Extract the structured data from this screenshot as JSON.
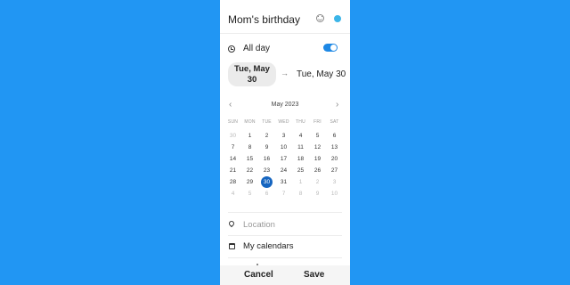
{
  "event": {
    "title": "Mom's birthday",
    "emoji_icon": "smiley-icon",
    "color": "#3BB5E8"
  },
  "all_day": {
    "label": "All day",
    "enabled": true,
    "icon": "clock-icon"
  },
  "dates": {
    "start_line1": "Tue, May",
    "start_line2": "30",
    "arrow": "→",
    "end": "Tue, May 30"
  },
  "calendar": {
    "month_label": "May 2023",
    "prev": "‹",
    "next": "›",
    "weekdays": [
      "SUN",
      "MON",
      "TUE",
      "WED",
      "THU",
      "FRI",
      "SAT"
    ],
    "weeks": [
      [
        {
          "d": "30",
          "m": true
        },
        {
          "d": "1"
        },
        {
          "d": "2"
        },
        {
          "d": "3"
        },
        {
          "d": "4"
        },
        {
          "d": "5"
        },
        {
          "d": "6"
        }
      ],
      [
        {
          "d": "7"
        },
        {
          "d": "8"
        },
        {
          "d": "9"
        },
        {
          "d": "10"
        },
        {
          "d": "11"
        },
        {
          "d": "12"
        },
        {
          "d": "13"
        }
      ],
      [
        {
          "d": "14"
        },
        {
          "d": "15"
        },
        {
          "d": "16"
        },
        {
          "d": "17"
        },
        {
          "d": "18"
        },
        {
          "d": "19"
        },
        {
          "d": "20"
        }
      ],
      [
        {
          "d": "21"
        },
        {
          "d": "22"
        },
        {
          "d": "23"
        },
        {
          "d": "24"
        },
        {
          "d": "25"
        },
        {
          "d": "26"
        },
        {
          "d": "27"
        }
      ],
      [
        {
          "d": "28"
        },
        {
          "d": "29"
        },
        {
          "d": "30",
          "sel": true
        },
        {
          "d": "31"
        },
        {
          "d": "1",
          "m": true
        },
        {
          "d": "2",
          "m": true
        },
        {
          "d": "3",
          "m": true
        }
      ],
      [
        {
          "d": "4",
          "m": true
        },
        {
          "d": "5",
          "m": true
        },
        {
          "d": "6",
          "m": true
        },
        {
          "d": "7",
          "m": true
        },
        {
          "d": "8",
          "m": true
        },
        {
          "d": "9",
          "m": true
        },
        {
          "d": "10",
          "m": true
        }
      ]
    ],
    "selected_color": "#1565C0"
  },
  "location": {
    "placeholder": "Location",
    "icon": "pin-icon"
  },
  "calendars": {
    "label": "My calendars",
    "icon": "calendar-icon"
  },
  "actions": {
    "cancel": "Cancel",
    "save": "Save"
  },
  "colors": {
    "background": "#2196F3",
    "toggle": "#1E88E5"
  }
}
